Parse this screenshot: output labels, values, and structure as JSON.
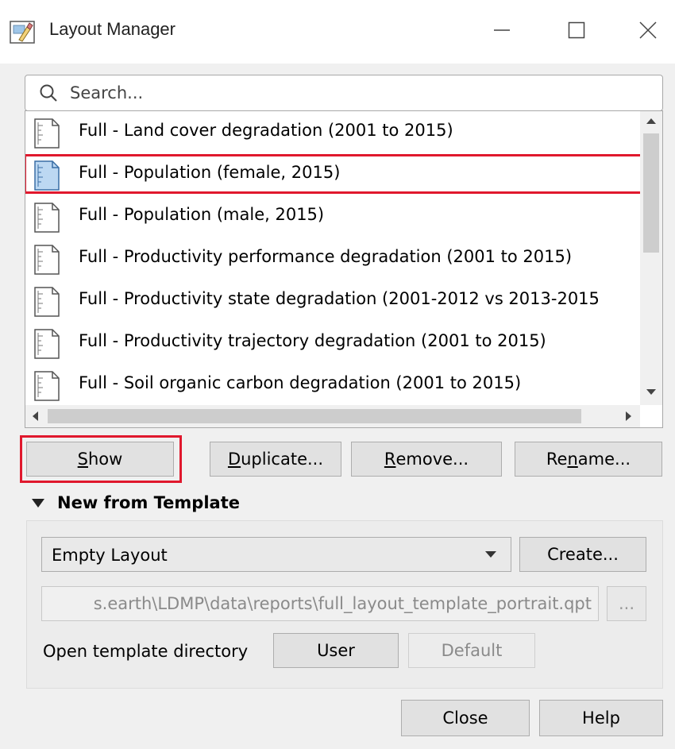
{
  "window": {
    "title": "Layout Manager",
    "icons": [
      "layout-manager-app-icon",
      "minimize-icon",
      "maximize-icon",
      "close-icon"
    ]
  },
  "search": {
    "placeholder": "Search...",
    "value": ""
  },
  "layouts": {
    "items": [
      {
        "label": "Full - Land cover degradation (2001 to 2015)",
        "selected": false
      },
      {
        "label": "Full - Population (female, 2015)",
        "selected": true
      },
      {
        "label": "Full - Population (male, 2015)",
        "selected": false
      },
      {
        "label": "Full - Productivity performance degradation (2001 to 2015)",
        "selected": false
      },
      {
        "label": "Full - Productivity state degradation (2001-2012 vs 2013-2015",
        "selected": false
      },
      {
        "label": "Full - Productivity trajectory degradation (2001 to 2015)",
        "selected": false
      },
      {
        "label": "Full - Soil organic carbon degradation (2001 to 2015)",
        "selected": false
      }
    ]
  },
  "actions": {
    "show": {
      "pre": "",
      "key": "S",
      "post": "how"
    },
    "duplicate": {
      "pre": "",
      "key": "D",
      "post": "uplicate..."
    },
    "remove": {
      "pre": "",
      "key": "R",
      "post": "emove..."
    },
    "rename": {
      "pre": "Re",
      "key": "n",
      "post": "ame..."
    }
  },
  "template": {
    "section_title": "New from Template",
    "selected_template": "Empty Layout",
    "create_label": "Create...",
    "path_value": "s.earth\\LDMP\\data\\reports\\full_layout_template_portrait.qpt",
    "browse_label": "...",
    "open_dir_label": "Open template directory",
    "user_label": "User",
    "default_label": "Default"
  },
  "footer": {
    "close_label": "Close",
    "help_label": "Help"
  },
  "colors": {
    "highlight_red": "#e0182d",
    "selected_icon_fill": "#bcd8f2"
  }
}
